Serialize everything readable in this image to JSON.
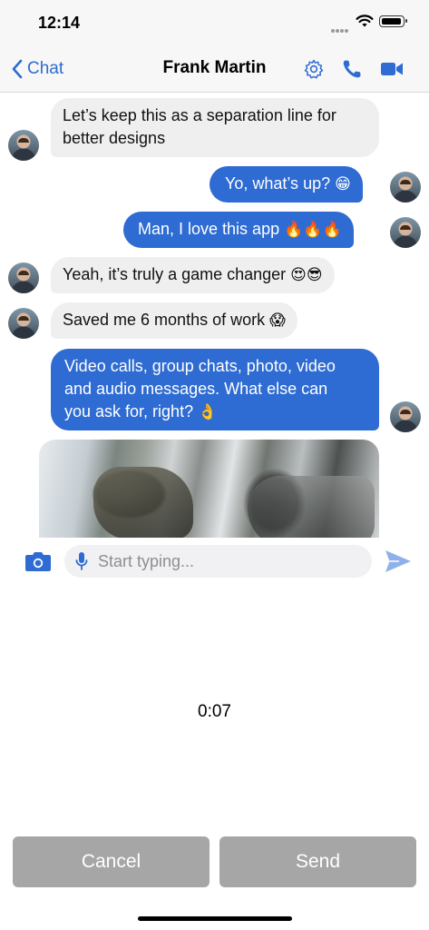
{
  "status_bar": {
    "time": "12:14"
  },
  "nav": {
    "back_label": "Chat",
    "title": "Frank Martin",
    "icons": [
      "chevron-left-icon",
      "gear-icon",
      "phone-icon",
      "video-camera-icon"
    ]
  },
  "colors": {
    "accent": "#2e6bd2",
    "incoming_bubble": "#efefef",
    "disabled_button": "#a6a6a6"
  },
  "messages": [
    {
      "direction": "incoming",
      "lines": [
        "Let’s keep this as a separation line for",
        "better designs"
      ]
    },
    {
      "direction": "outgoing",
      "text": "Yo, what’s up?",
      "emoji": "😁"
    },
    {
      "direction": "outgoing",
      "text": "Man, I love this app",
      "emoji": "🔥🔥🔥"
    },
    {
      "direction": "incoming",
      "text": "Yeah, it’s truly a game changer",
      "emoji": "😍😎"
    },
    {
      "direction": "incoming",
      "text": "Saved me 6 months of work",
      "emoji": "😱"
    },
    {
      "direction": "outgoing",
      "lines": [
        "Video calls, group chats, photo, video",
        "and audio messages. What else can",
        "you ask for, right?"
      ],
      "emoji": "👌"
    },
    {
      "direction": "incoming",
      "type": "photo"
    }
  ],
  "composer": {
    "placeholder": "Start typing..."
  },
  "recording": {
    "timer": "0:07"
  },
  "buttons": {
    "cancel": "Cancel",
    "send": "Send"
  }
}
